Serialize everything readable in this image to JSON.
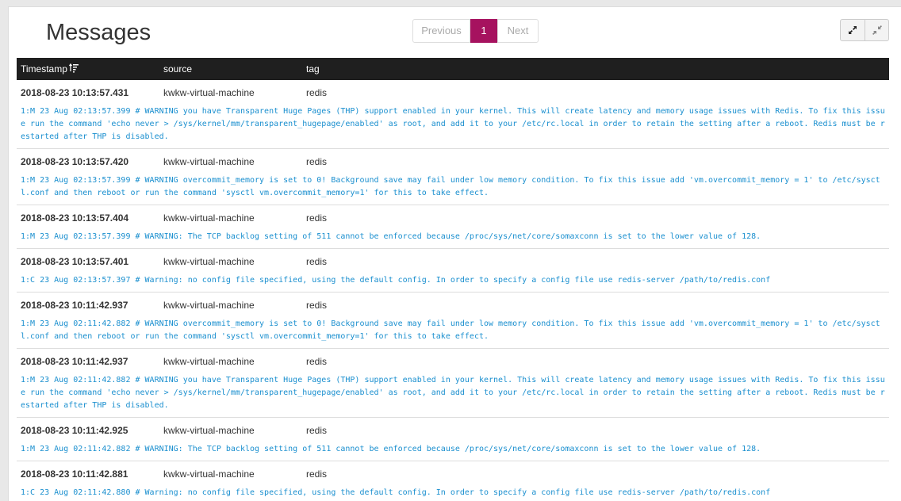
{
  "header": {
    "title": "Messages"
  },
  "pagination": {
    "previous_label": "Previous",
    "current_page": "1",
    "next_label": "Next"
  },
  "view_controls": {
    "expand_icon": "expand-icon",
    "collapse_icon": "compress-icon"
  },
  "table": {
    "columns": {
      "timestamp": "Timestamp",
      "source": "source",
      "tag": "tag"
    },
    "sort_icon": "sort-descending-icon",
    "rows": [
      {
        "timestamp": "2018-08-23 10:13:57.431",
        "source": "kwkw-virtual-machine",
        "tag": "redis",
        "message": "1:M 23 Aug 02:13:57.399 # WARNING you have Transparent Huge Pages (THP) support enabled in your kernel. This will create latency and memory usage issues with Redis. To fix this issue run the command 'echo never > /sys/kernel/mm/transparent_hugepage/enabled' as root, and add it to your /etc/rc.local in order to retain the setting after a reboot. Redis must be restarted after THP is disabled."
      },
      {
        "timestamp": "2018-08-23 10:13:57.420",
        "source": "kwkw-virtual-machine",
        "tag": "redis",
        "message": "1:M 23 Aug 02:13:57.399 # WARNING overcommit_memory is set to 0! Background save may fail under low memory condition. To fix this issue add 'vm.overcommit_memory = 1' to /etc/sysctl.conf and then reboot or run the command 'sysctl vm.overcommit_memory=1' for this to take effect."
      },
      {
        "timestamp": "2018-08-23 10:13:57.404",
        "source": "kwkw-virtual-machine",
        "tag": "redis",
        "message": "1:M 23 Aug 02:13:57.399 # WARNING: The TCP backlog setting of 511 cannot be enforced because /proc/sys/net/core/somaxconn is set to the lower value of 128."
      },
      {
        "timestamp": "2018-08-23 10:13:57.401",
        "source": "kwkw-virtual-machine",
        "tag": "redis",
        "message": "1:C 23 Aug 02:13:57.397 # Warning: no config file specified, using the default config. In order to specify a config file use redis-server /path/to/redis.conf"
      },
      {
        "timestamp": "2018-08-23 10:11:42.937",
        "source": "kwkw-virtual-machine",
        "tag": "redis",
        "message": "1:M 23 Aug 02:11:42.882 # WARNING overcommit_memory is set to 0! Background save may fail under low memory condition. To fix this issue add 'vm.overcommit_memory = 1' to /etc/sysctl.conf and then reboot or run the command 'sysctl vm.overcommit_memory=1' for this to take effect."
      },
      {
        "timestamp": "2018-08-23 10:11:42.937",
        "source": "kwkw-virtual-machine",
        "tag": "redis",
        "message": "1:M 23 Aug 02:11:42.882 # WARNING you have Transparent Huge Pages (THP) support enabled in your kernel. This will create latency and memory usage issues with Redis. To fix this issue run the command 'echo never > /sys/kernel/mm/transparent_hugepage/enabled' as root, and add it to your /etc/rc.local in order to retain the setting after a reboot. Redis must be restarted after THP is disabled."
      },
      {
        "timestamp": "2018-08-23 10:11:42.925",
        "source": "kwkw-virtual-machine",
        "tag": "redis",
        "message": "1:M 23 Aug 02:11:42.882 # WARNING: The TCP backlog setting of 511 cannot be enforced because /proc/sys/net/core/somaxconn is set to the lower value of 128."
      },
      {
        "timestamp": "2018-08-23 10:11:42.881",
        "source": "kwkw-virtual-machine",
        "tag": "redis",
        "message": "1:C 23 Aug 02:11:42.880 # Warning: no config file specified, using the default config. In order to specify a config file use redis-server /path/to/redis.conf"
      }
    ]
  },
  "colors": {
    "accent": "#a6125f",
    "header_bg": "#1f1f1f",
    "message_text": "#1a8fcf"
  }
}
